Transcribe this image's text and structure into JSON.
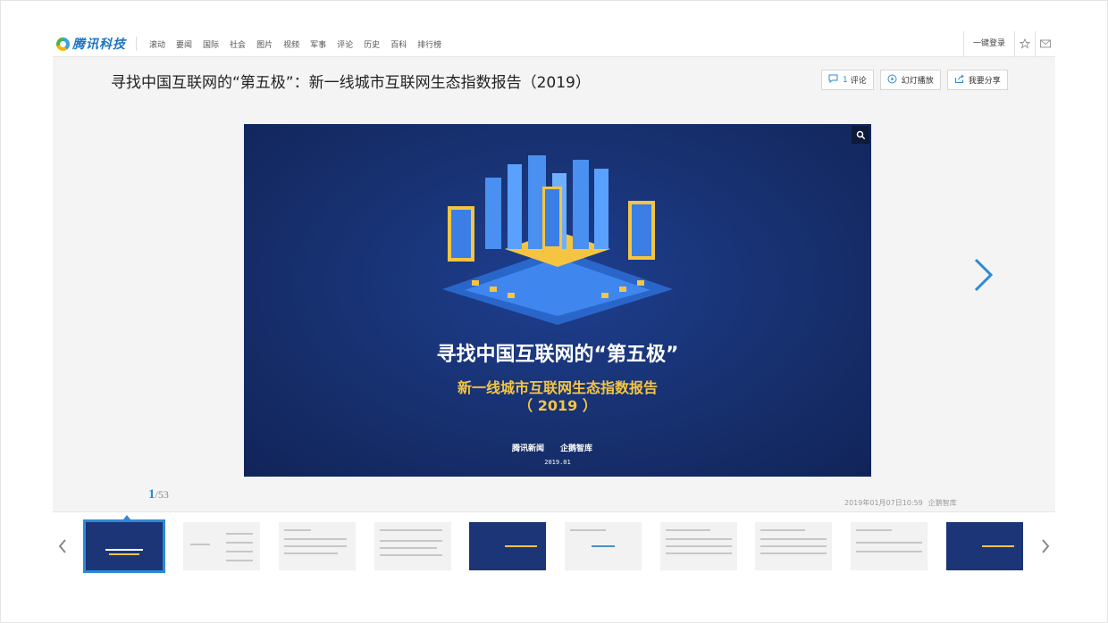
{
  "brand": {
    "logo_text": "腾讯科技"
  },
  "nav": {
    "items": [
      "滚动",
      "要闻",
      "国际",
      "社会",
      "图片",
      "视频",
      "军事",
      "评论",
      "历史",
      "百科",
      "排行榜"
    ],
    "login": "一键登录",
    "star_icon": "star-icon",
    "mail_icon": "mail-icon"
  },
  "article": {
    "title": "寻找中国互联网的“第五极”：新一线城市互联网生态指数报告（2019）"
  },
  "actions": {
    "comment_count": "1",
    "comment_label": "评论",
    "slideshow_label": "幻灯播放",
    "share_label": "我要分享"
  },
  "slide": {
    "title": "寻找中国互联网的“第五极”",
    "subtitle": "新一线城市互联网生态指数报告",
    "year": "（ 2019 ）",
    "brand_left": "腾讯新闻",
    "brand_right": "企鹅智库",
    "date": "2019.01"
  },
  "pager": {
    "current": "1",
    "total": "/53"
  },
  "meta": {
    "datetime": "2019年01月07日10:59",
    "source": "企鹅智库"
  },
  "thumbnails": [
    {
      "label": "slide-1",
      "dark": true
    },
    {
      "label": "slide-2",
      "dark": false
    },
    {
      "label": "slide-3",
      "dark": false
    },
    {
      "label": "slide-4",
      "dark": false
    },
    {
      "label": "slide-5",
      "dark": true
    },
    {
      "label": "slide-6",
      "dark": false
    },
    {
      "label": "slide-7",
      "dark": false
    },
    {
      "label": "slide-8",
      "dark": false
    },
    {
      "label": "slide-9",
      "dark": false
    },
    {
      "label": "slide-10",
      "dark": true
    }
  ],
  "colors": {
    "accent": "#2b8ad8",
    "slide_bg": "#17306f",
    "slide_yellow": "#f5c542"
  }
}
